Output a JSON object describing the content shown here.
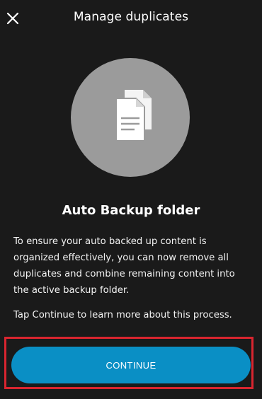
{
  "header": {
    "title": "Manage duplicates",
    "close_icon": "close-icon"
  },
  "hero": {
    "icon": "duplicate-documents-icon",
    "circle_color": "#9b9b9b"
  },
  "content": {
    "headline": "Auto Backup folder",
    "paragraph1": "To ensure your auto backed up content is organized effectively, you can now remove all duplicates and combine remaining content into the active backup folder.",
    "paragraph2": "Tap Continue to learn more about this process."
  },
  "actions": {
    "continue_label": "CONTINUE",
    "button_color": "#0a8fc5",
    "highlight_color": "#d9252f"
  }
}
